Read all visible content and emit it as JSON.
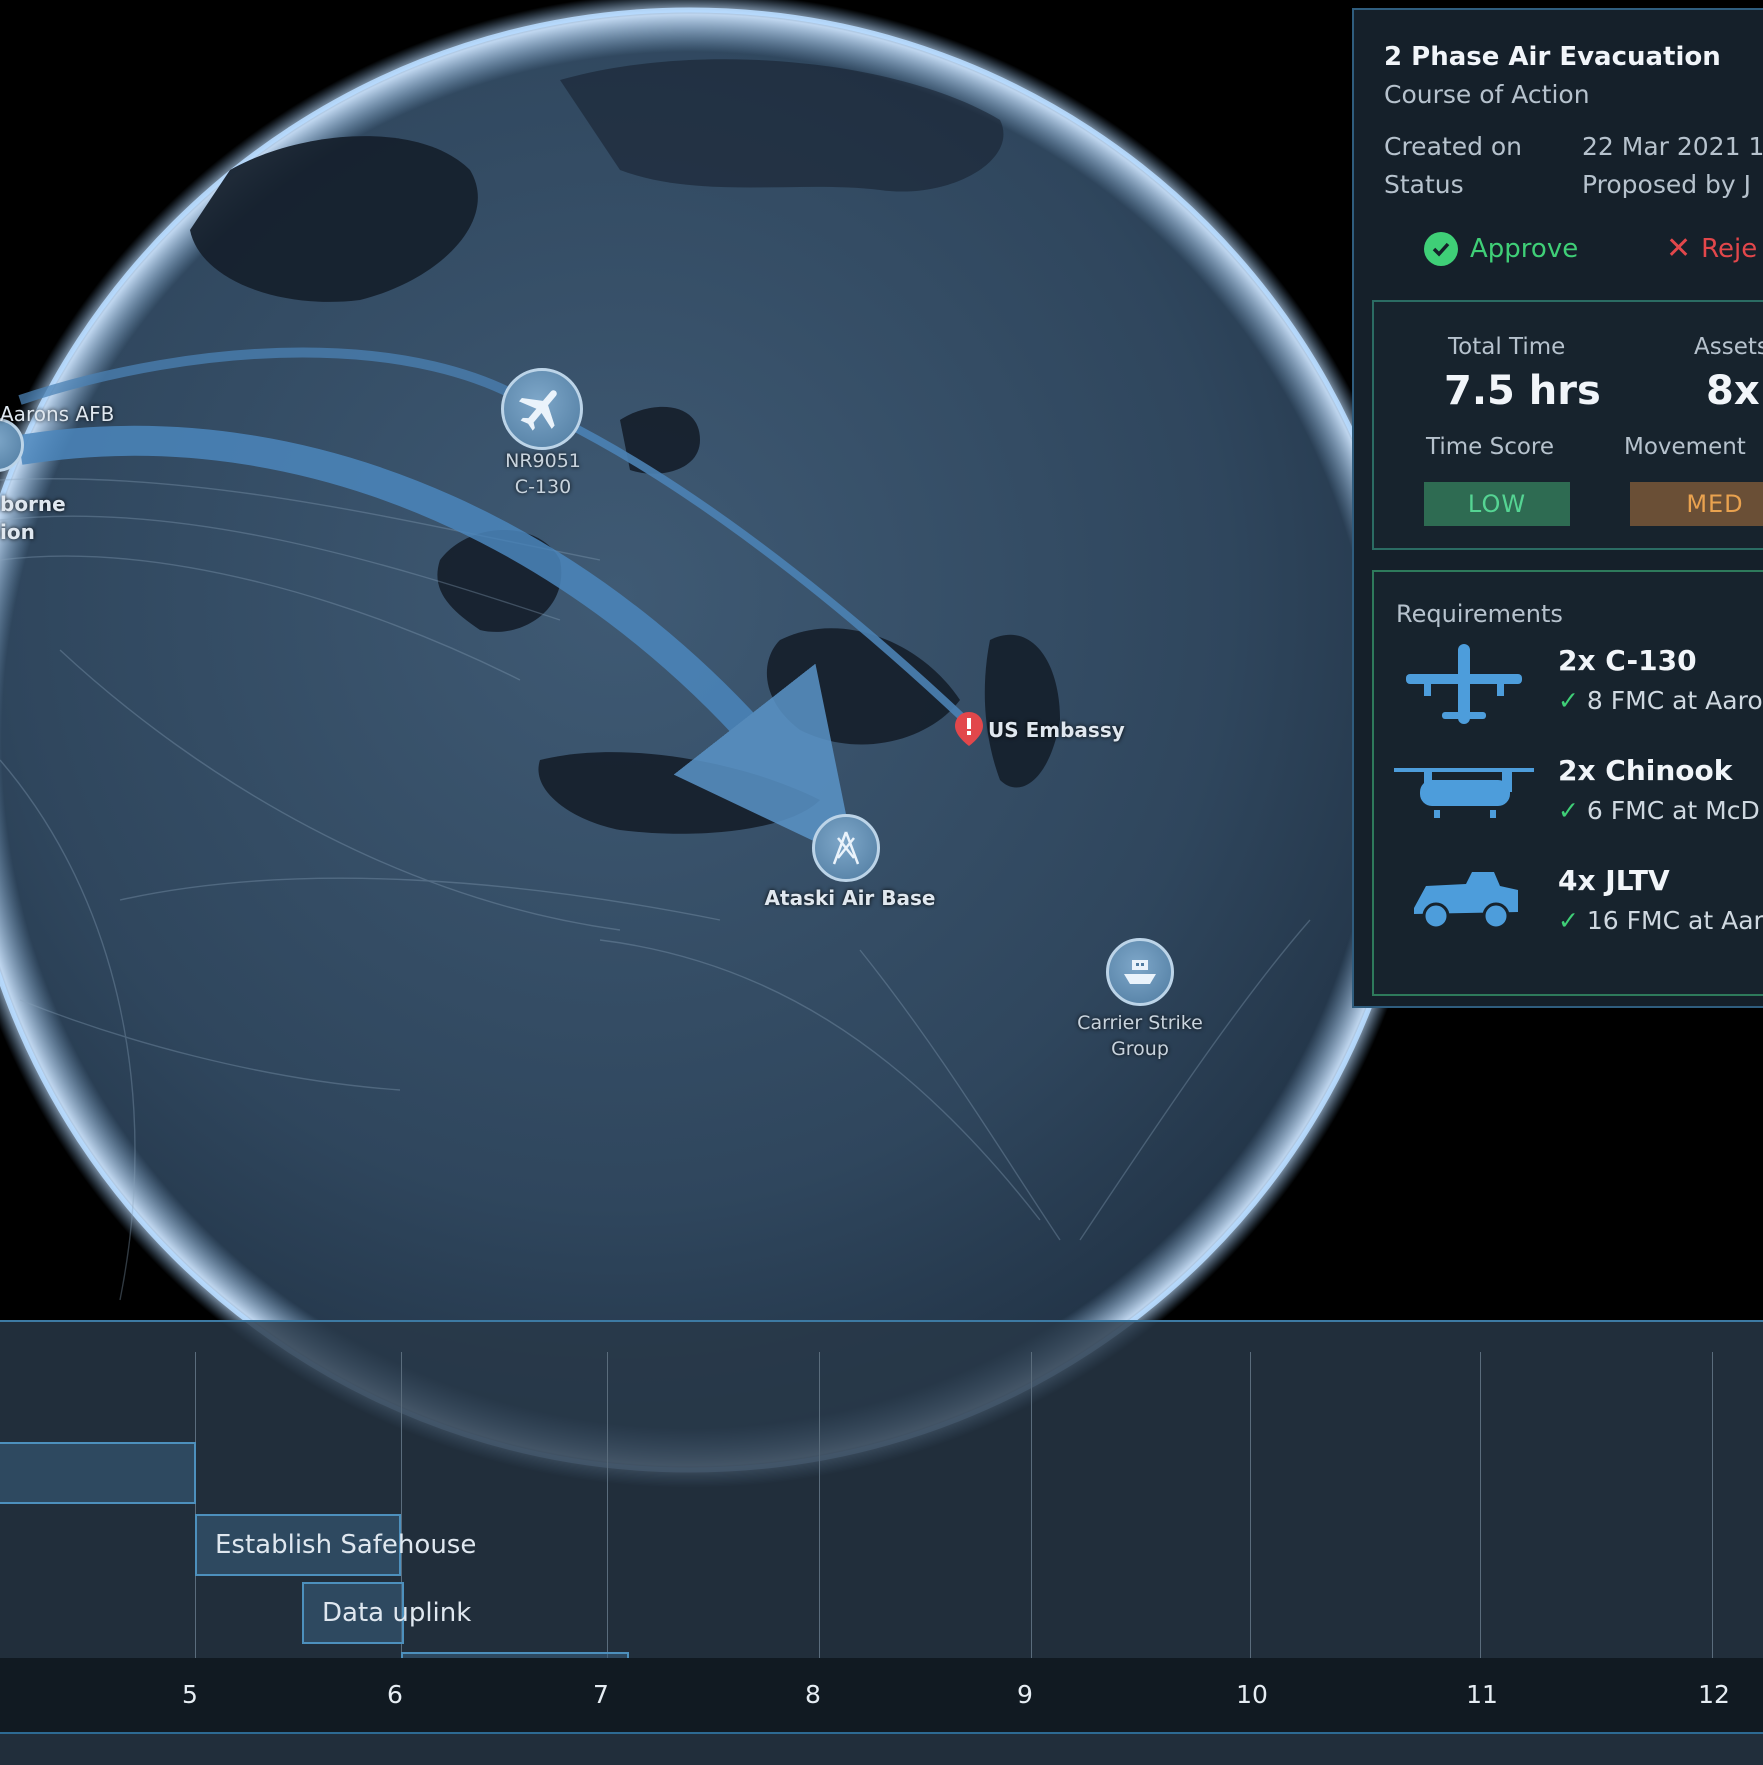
{
  "map": {
    "labels": {
      "aarons_afb": "Aarons AFB",
      "airborne_1": "borne",
      "airborne_2": "ion",
      "aircraft_1": "NR9051",
      "aircraft_2": "C-130",
      "embassy": "US Embassy",
      "air_base": "Ataski Air Base",
      "carrier_1": "Carrier Strike",
      "carrier_2": "Group"
    },
    "icons": [
      "airplane-icon",
      "airbase-icon",
      "location-pin-icon",
      "ship-icon"
    ]
  },
  "coa": {
    "title": "2 Phase Air Evacuation",
    "subtitle": "Course of Action",
    "created_label": "Created on",
    "created_value": "22 Mar 2021 1",
    "status_label": "Status",
    "status_value": "Proposed by J",
    "approve_label": "Approve",
    "reject_label": "Reje",
    "total_time_label": "Total Time",
    "total_time_value": "7.5 hrs",
    "assets_label": "Assets",
    "assets_value": "8x",
    "time_score_label": "Time Score",
    "time_score_value": "LOW",
    "movement_label": "Movement",
    "movement_value": "MED",
    "requirements_label": "Requirements",
    "requirements": [
      {
        "title": "2x C-130",
        "detail": "8 FMC at Aaro",
        "icon": "c130-aircraft-icon"
      },
      {
        "title": "2x Chinook",
        "detail": "6 FMC at McD",
        "icon": "chinook-helicopter-icon"
      },
      {
        "title": "4x JLTV",
        "detail": "16 FMC at Aar",
        "icon": "jltv-vehicle-icon"
      }
    ],
    "colors": {
      "approve": "#3fcf77",
      "reject": "#e2474b",
      "low": "#2e6b52",
      "med": "#6a4f36"
    }
  },
  "timeline": {
    "tasks": [
      "Establish Safehouse",
      "Data uplink"
    ],
    "ticks": [
      "5",
      "6",
      "7",
      "8",
      "9",
      "10",
      "11",
      "12"
    ]
  }
}
